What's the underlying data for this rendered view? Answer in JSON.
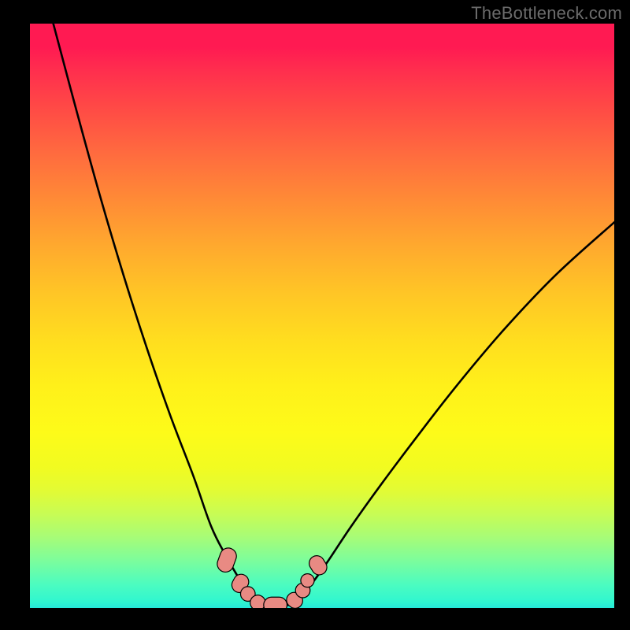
{
  "watermark": "TheBottleneck.com",
  "colors": {
    "curve_stroke": "#000000",
    "marker_fill": "#e88a83",
    "marker_stroke": "#000000",
    "background_black": "#000000"
  },
  "chart_data": {
    "type": "line",
    "title": "",
    "xlabel": "",
    "ylabel": "",
    "xlim": [
      0,
      100
    ],
    "ylim": [
      0,
      100
    ],
    "grid": false,
    "legend": false,
    "series": [
      {
        "name": "left-curve",
        "x": [
          4,
          8,
          12,
          16,
          20,
          24,
          28,
          31,
          33.5,
          35.5,
          37,
          38,
          39
        ],
        "y": [
          100,
          85,
          70.5,
          57,
          44.5,
          33,
          22.5,
          14,
          9,
          5.5,
          3,
          1.5,
          0.5
        ]
      },
      {
        "name": "right-curve",
        "x": [
          45,
          46.5,
          48.5,
          51,
          55,
          60,
          66,
          73,
          81,
          90,
          100
        ],
        "y": [
          0.5,
          2,
          4.5,
          8,
          14,
          21,
          29,
          38,
          47.5,
          57,
          66
        ]
      },
      {
        "name": "floor",
        "x": [
          39,
          45
        ],
        "y": [
          0.5,
          0.5
        ]
      }
    ],
    "markers": [
      {
        "kind": "pill",
        "cx": 33.7,
        "cy": 8.2,
        "angle": 70,
        "len": 4.2,
        "r": 1.4
      },
      {
        "kind": "pill",
        "cx": 36.0,
        "cy": 4.2,
        "angle": 62,
        "len": 3.2,
        "r": 1.3
      },
      {
        "kind": "circle",
        "cx": 37.3,
        "cy": 2.4,
        "r": 1.25
      },
      {
        "kind": "pill",
        "cx": 39.0,
        "cy": 0.9,
        "angle": 25,
        "len": 2.6,
        "r": 1.3
      },
      {
        "kind": "pill",
        "cx": 42.0,
        "cy": 0.5,
        "angle": 0,
        "len": 4.0,
        "r": 1.35
      },
      {
        "kind": "pill",
        "cx": 45.3,
        "cy": 1.3,
        "angle": -38,
        "len": 2.8,
        "r": 1.3
      },
      {
        "kind": "circle",
        "cx": 46.7,
        "cy": 3.0,
        "r": 1.25
      },
      {
        "kind": "circle",
        "cx": 47.5,
        "cy": 4.7,
        "r": 1.15
      },
      {
        "kind": "pill",
        "cx": 49.3,
        "cy": 7.3,
        "angle": -58,
        "len": 3.4,
        "r": 1.3
      }
    ]
  }
}
